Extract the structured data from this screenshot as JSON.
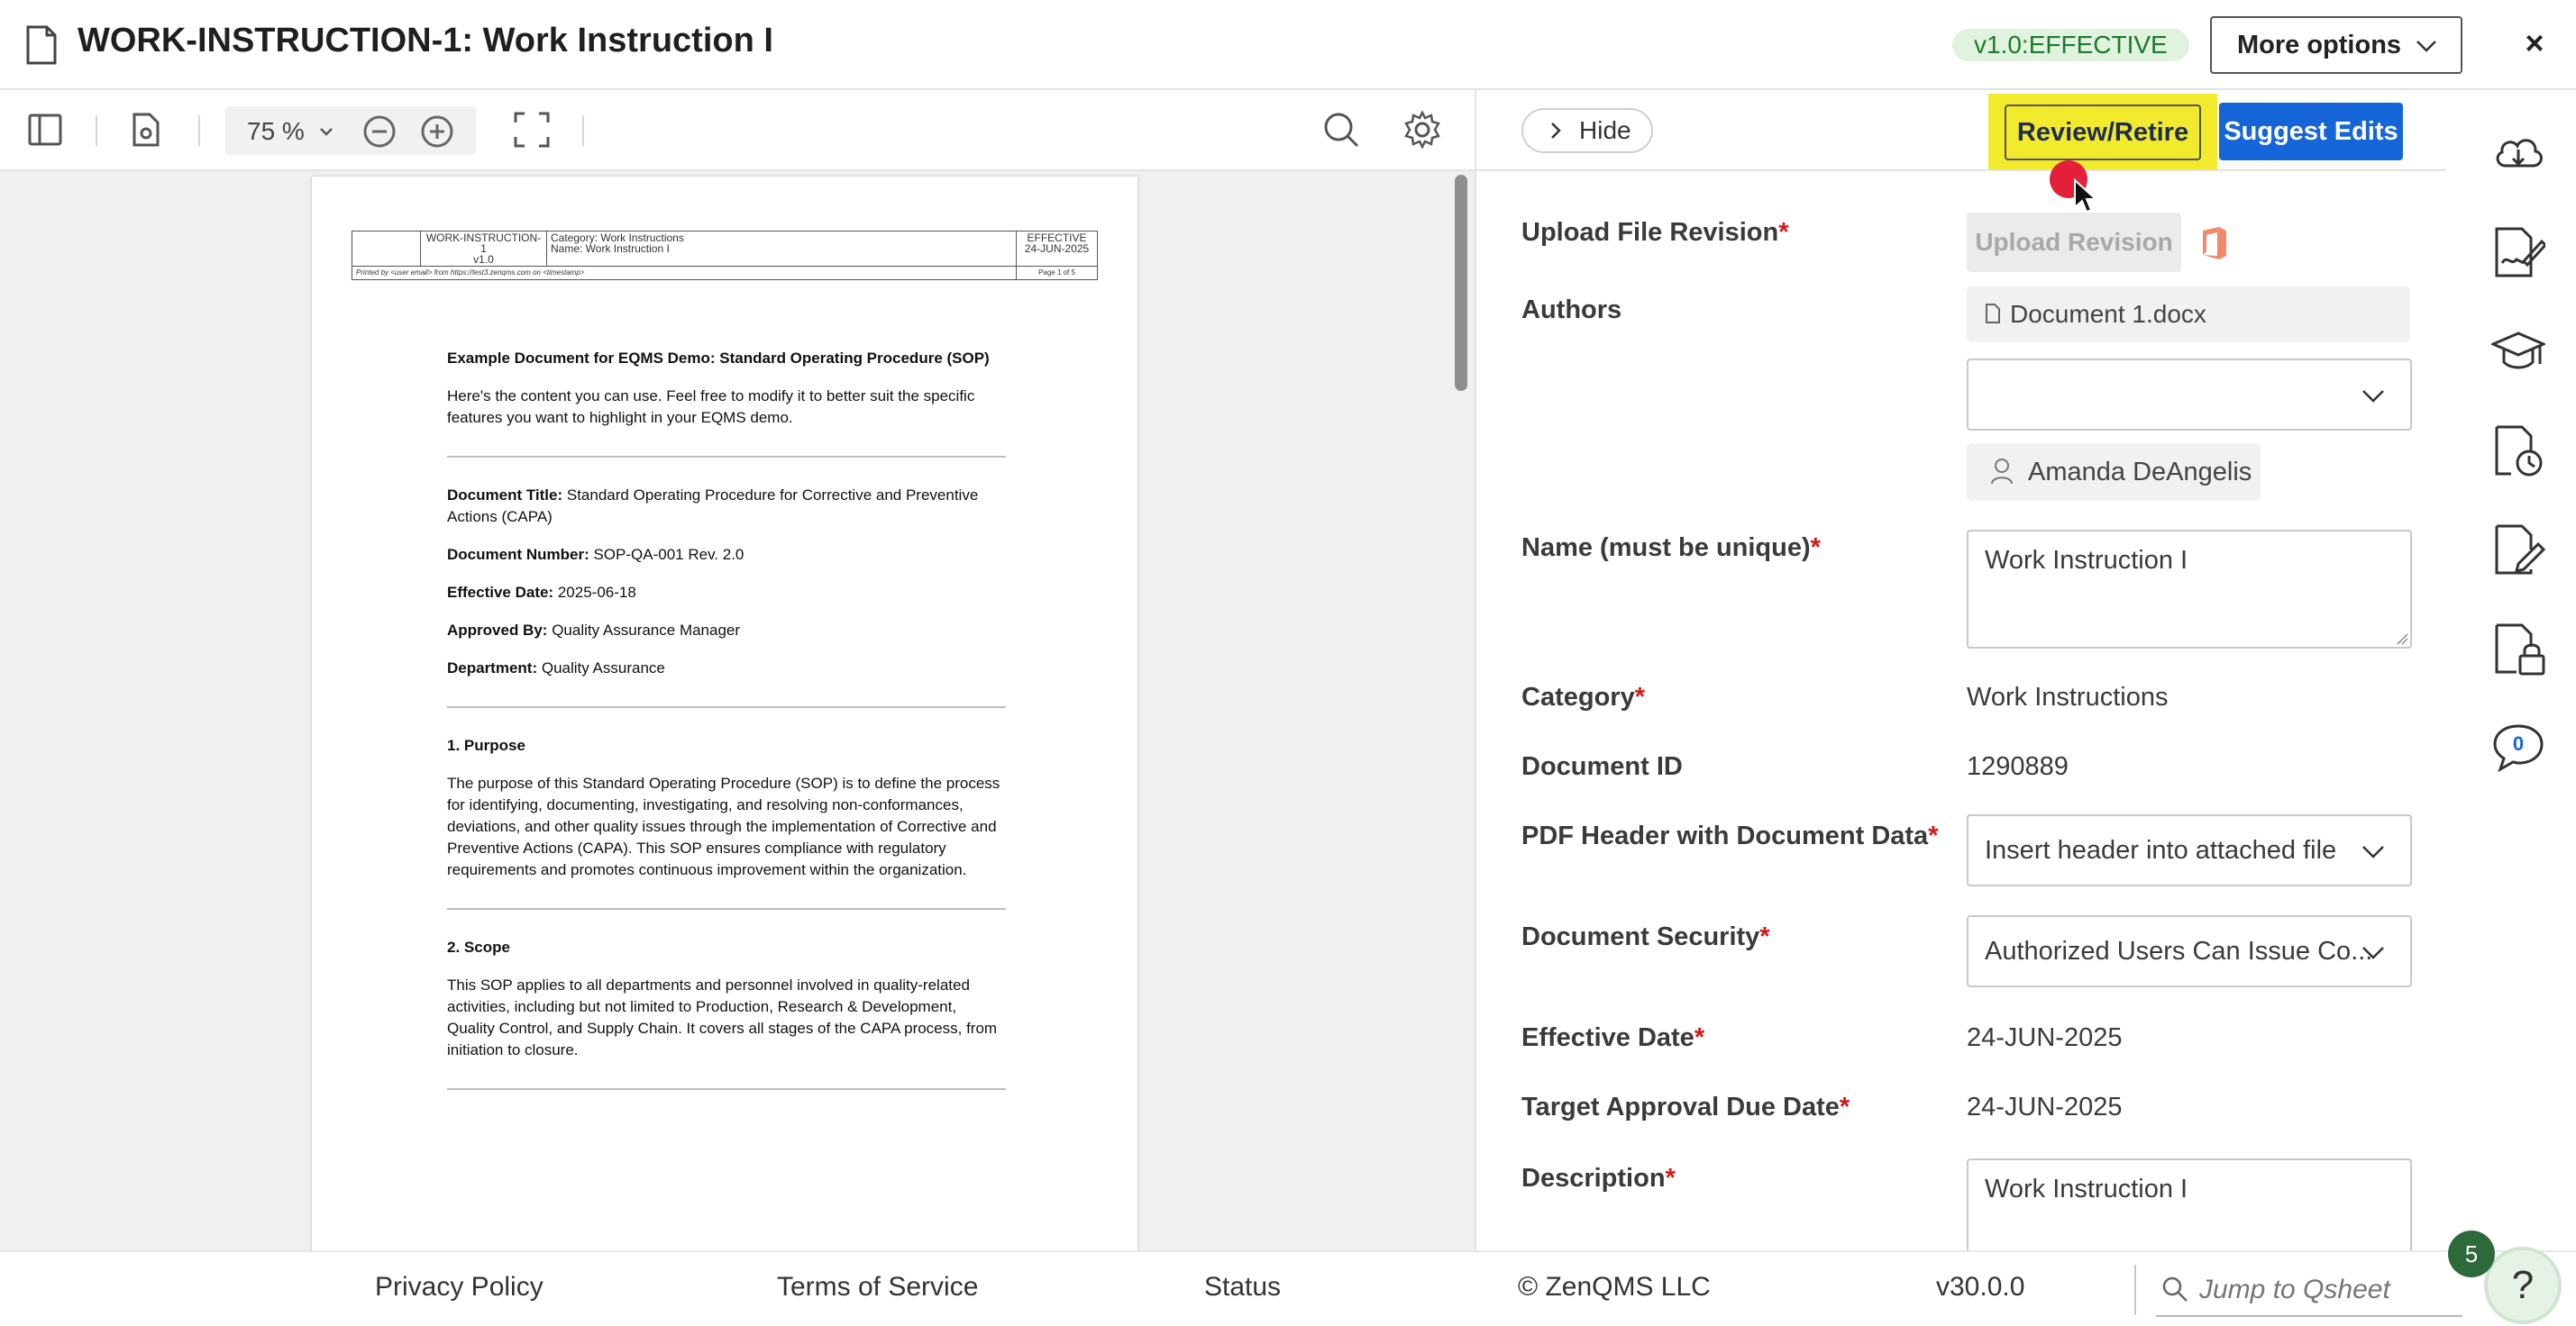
{
  "header": {
    "title": "WORK-INSTRUCTION-1: Work Instruction I",
    "status": "v1.0:EFFECTIVE",
    "more_options": "More options",
    "close_symbol": "×",
    "colors": {
      "status_bg": "#dff3df",
      "status_text": "#1f7a2a"
    }
  },
  "viewer": {
    "zoom": "75 %",
    "page_header": {
      "doc_id": "WORK-INSTRUCTION-1",
      "version": "v1.0",
      "category": "Category: Work Instructions",
      "name": "Name: Work Instruction I",
      "status": "EFFECTIVE",
      "date": "24-JUN-2025",
      "printed_by": "Printed by <user email> from https://test3.zenqms.com on <timestamp>",
      "page": "Page 1 of 5"
    },
    "content": {
      "title": "Example Document for EQMS Demo: Standard Operating Procedure (SOP)",
      "intro": "Here's the content you can use. Feel free to modify it to better suit the specific features you want to highlight in your EQMS demo.",
      "meta": [
        {
          "label": "Document Title:",
          "value": "Standard Operating Procedure for Corrective and Preventive Actions (CAPA)"
        },
        {
          "label": "Document Number:",
          "value": "SOP-QA-001 Rev. 2.0"
        },
        {
          "label": "Effective Date:",
          "value": "2025-06-18"
        },
        {
          "label": "Approved By:",
          "value": "Quality Assurance Manager"
        },
        {
          "label": "Department:",
          "value": "Quality Assurance"
        }
      ],
      "sections": [
        {
          "heading": "1. Purpose",
          "text": "The purpose of this Standard Operating Procedure (SOP) is to define the process for identifying, documenting, investigating, and resolving non-conformances, deviations, and other quality issues through the implementation of Corrective and Preventive Actions (CAPA). This SOP ensures compliance with regulatory requirements and promotes continuous improvement within the organization."
        },
        {
          "heading": "2. Scope",
          "text": "This SOP applies to all departments and personnel involved in quality-related activities, including but not limited to Production, Research & Development, Quality Control, and Supply Chain. It covers all stages of the CAPA process, from initiation to closure."
        }
      ]
    }
  },
  "panel": {
    "hide_label": "Hide",
    "review_label": "Review/Retire",
    "suggest_label": "Suggest Edits",
    "colors": {
      "review_highlight": "#f2ea2c",
      "suggest_bg": "#1565d8",
      "required": "#d31616"
    },
    "fields": {
      "upload_label": "Upload File Revision",
      "upload_button": "Upload Revision",
      "file_name": "Document 1.docx",
      "authors_label": "Authors",
      "authors_value": "",
      "author_chip": "Amanda DeAngelis",
      "name_label": "Name (must be unique)",
      "name_value": "Work Instruction I",
      "category_label": "Category",
      "category_value": "Work Instructions",
      "docid_label": "Document ID",
      "docid_value": "1290889",
      "pdfheader_label": "PDF Header with Document Data",
      "pdfheader_value": "Insert header into attached file",
      "security_label": "Document Security",
      "security_value": "Authorized Users Can Issue Co...",
      "effective_label": "Effective Date",
      "effective_value": "24-JUN-2025",
      "target_label": "Target Approval Due Date",
      "target_value": "24-JUN-2025",
      "description_label": "Description",
      "description_value": "Work Instruction I",
      "required_mark": "*"
    }
  },
  "rail": {
    "icons": [
      "cloud-download-icon",
      "signature-doc-icon",
      "graduation-cap-icon",
      "doc-history-icon",
      "doc-edit-icon",
      "doc-lock-icon",
      "chat-icon"
    ],
    "chat_count": "0"
  },
  "footer": {
    "privacy": "Privacy Policy",
    "terms": "Terms of Service",
    "status": "Status",
    "copyright": "© ZenQMS LLC",
    "version": "v30.0.0",
    "search_placeholder": "Jump to Qsheet",
    "help_badge": "5",
    "help_symbol": "?"
  }
}
